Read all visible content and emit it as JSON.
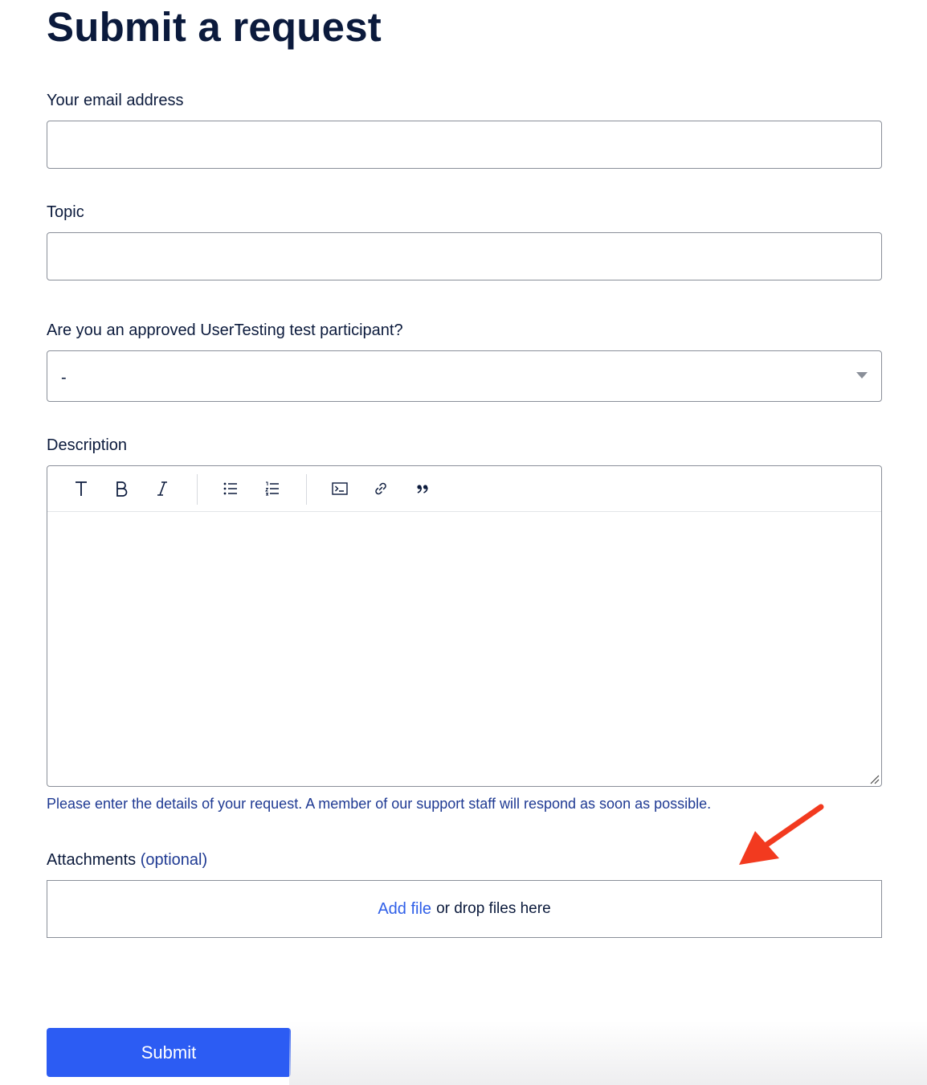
{
  "page": {
    "title": "Submit a request"
  },
  "form": {
    "email": {
      "label": "Your email address",
      "value": ""
    },
    "topic": {
      "label": "Topic",
      "value": ""
    },
    "participant": {
      "label": "Are you an approved UserTesting test participant?",
      "selected": "-"
    },
    "description": {
      "label": "Description",
      "hint": "Please enter the details of your request. A member of our support staff will respond as soon as possible.",
      "toolbar": [
        "text-icon",
        "bold-icon",
        "italic-icon",
        "bullet-list-icon",
        "numbered-list-icon",
        "code-block-icon",
        "link-icon",
        "quote-icon"
      ]
    },
    "attachments": {
      "label": "Attachments",
      "optional": "(optional)",
      "add_file": "Add file",
      "drop_text": "or drop files here"
    },
    "submit_label": "Submit"
  },
  "colors": {
    "primary": "#2c5cf3",
    "link": "#2f5fe8",
    "hint": "#1f3a93",
    "annotation_arrow": "#f23a1f"
  }
}
